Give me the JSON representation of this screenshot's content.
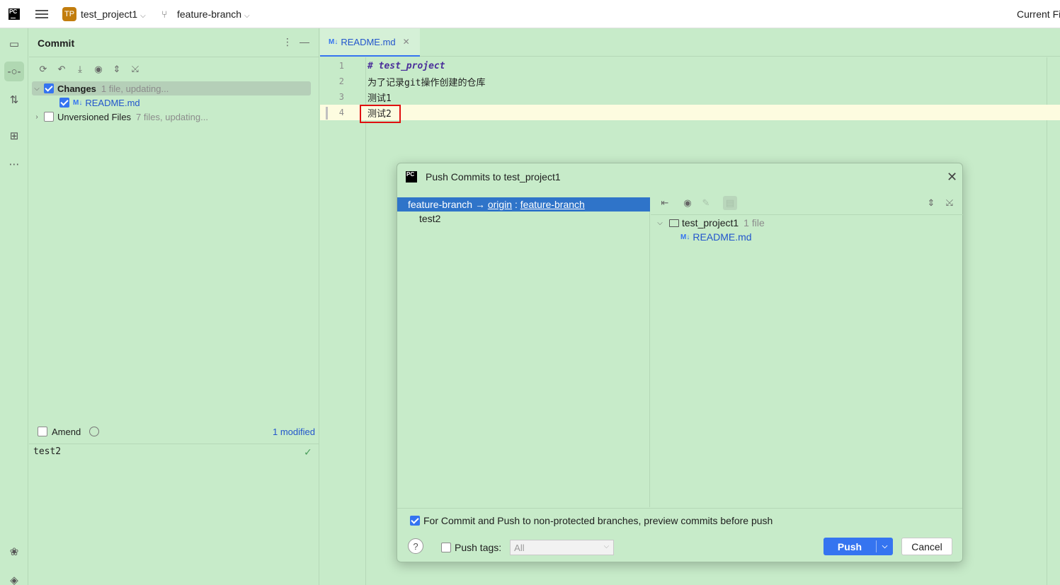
{
  "titlebar": {
    "logo_text": "PC",
    "project_badge": "TP",
    "project_name": "test_project1",
    "branch_name": "feature-branch",
    "current_file": "Current Fi"
  },
  "commit_panel": {
    "title": "Commit",
    "changes_label": "Changes",
    "changes_meta": "1 file, updating...",
    "changed_file": "README.md",
    "unversioned_label": "Unversioned Files",
    "unversioned_meta": "7 files, updating...",
    "amend_label": "Amend",
    "modified_count": "1 modified",
    "commit_message": "test2"
  },
  "editor": {
    "tab_label": "README.md",
    "md_badge": "M↓",
    "lines": [
      {
        "no": "1",
        "text": "# test_project"
      },
      {
        "no": "2",
        "text": "为了记录git操作创建的仓库"
      },
      {
        "no": "3",
        "text": "测试1"
      },
      {
        "no": "4",
        "text": "测试2"
      }
    ]
  },
  "dialog": {
    "title": "Push Commits to test_project1",
    "local_branch": "feature-branch",
    "arrow": "→",
    "remote": "origin",
    "colon": ":",
    "remote_branch": "feature-branch",
    "commit": "test2",
    "folder_name": "test_project1",
    "folder_meta": "1 file",
    "file_name": "README.md",
    "preview_label": "For Commit and Push to non-protected branches, preview commits before push",
    "push_tags_label": "Push tags:",
    "push_tags_value": "All",
    "push_label": "Push",
    "cancel_label": "Cancel",
    "help_label": "?"
  }
}
